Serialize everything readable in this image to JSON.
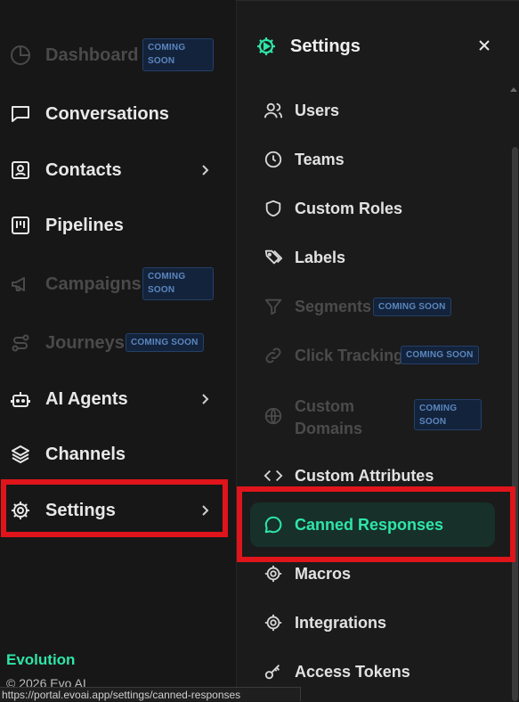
{
  "sidebar": {
    "items": [
      {
        "label": "Dashboard",
        "badge": "COMING SOON",
        "icon": "pie-chart-icon"
      },
      {
        "label": "Conversations",
        "icon": "chat-icon"
      },
      {
        "label": "Contacts",
        "icon": "contact-card-icon"
      },
      {
        "label": "Pipelines",
        "icon": "kanban-icon"
      },
      {
        "label": "Campaigns",
        "badge": "COMING SOON",
        "icon": "megaphone-icon"
      },
      {
        "label": "Journeys",
        "badge": "COMING SOON",
        "icon": "route-icon"
      },
      {
        "label": "AI Agents",
        "icon": "bot-icon"
      },
      {
        "label": "Channels",
        "icon": "layers-icon"
      },
      {
        "label": "Settings",
        "icon": "gear-icon"
      }
    ],
    "badge_line1": "COMING",
    "badge_line2": "SOON",
    "brand": "Evolution",
    "copyright": "© 2026 Evo AI"
  },
  "settings": {
    "title": "Settings",
    "items": [
      {
        "label": "Users",
        "icon": "users-icon"
      },
      {
        "label": "Teams",
        "icon": "clock-icon"
      },
      {
        "label": "Custom Roles",
        "icon": "shield-icon"
      },
      {
        "label": "Labels",
        "icon": "tags-icon"
      },
      {
        "label": "Segments",
        "badge": "COMING SOON",
        "icon": "filter-icon"
      },
      {
        "label": "Click Tracking",
        "badge": "COMING SOON",
        "icon": "link-icon"
      },
      {
        "label": "Custom Domains",
        "label_line1": "Custom",
        "label_line2": "Domains",
        "badge": "COMING SOON",
        "icon": "globe-icon"
      },
      {
        "label": "Custom Attributes",
        "icon": "code-icon"
      },
      {
        "label": "Canned Responses",
        "icon": "message-circle-icon"
      },
      {
        "label": "Macros",
        "icon": "gear-icon"
      },
      {
        "label": "Integrations",
        "icon": "gear-icon"
      },
      {
        "label": "Access Tokens",
        "icon": "key-icon"
      }
    ]
  },
  "status_url": "https://portal.evoai.app/settings/canned-responses",
  "colors": {
    "accent": "#2ee6a8",
    "highlight": "#e0141b",
    "badge_text": "#5b86bf"
  }
}
